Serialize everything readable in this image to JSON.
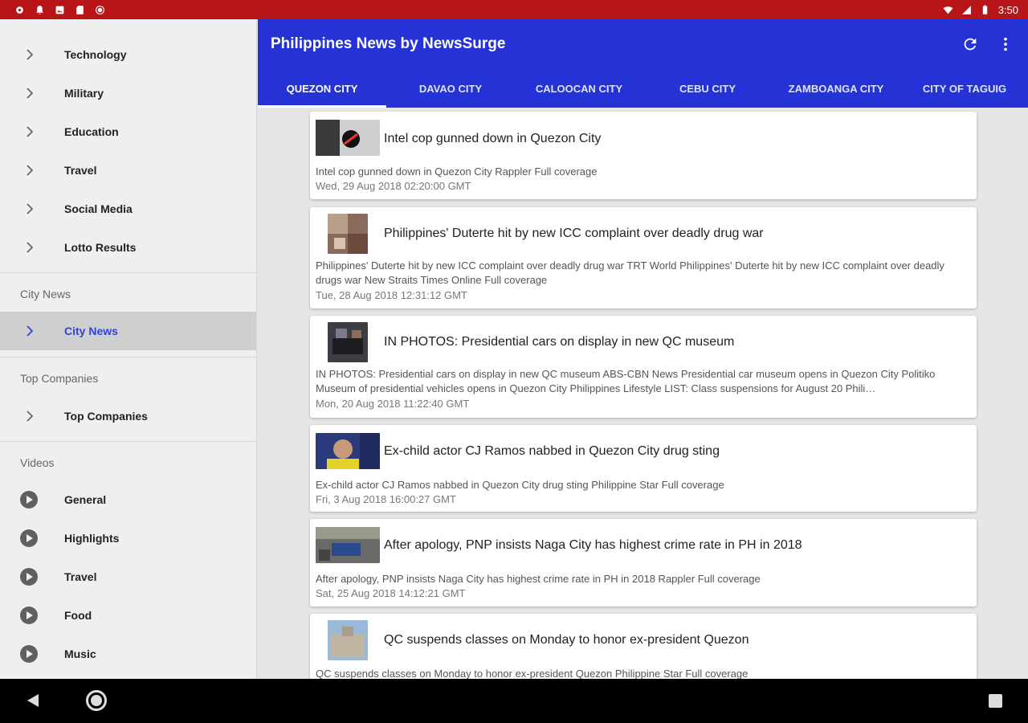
{
  "status_bar": {
    "time": "3:50",
    "bg": "#b71518"
  },
  "app": {
    "title": "Philippines News by NewsSurge",
    "accent": "#2432d6"
  },
  "tabs": [
    "QUEZON CITY",
    "DAVAO CITY",
    "CALOOCAN CITY",
    "CEBU CITY",
    "ZAMBOANGA CITY",
    "CITY OF TAGUIG"
  ],
  "selected_tab": "QUEZON CITY",
  "drawer": {
    "categories": [
      "Technology",
      "Military",
      "Education",
      "Travel",
      "Social Media",
      "Lotto Results"
    ],
    "city_news_header": "City News",
    "city_news_item": "City News",
    "top_companies_header": "Top Companies",
    "top_companies_item": "Top Companies",
    "videos_header": "Videos",
    "videos": [
      "General",
      "Highlights",
      "Travel",
      "Food",
      "Music"
    ]
  },
  "articles": [
    {
      "headline": "Intel cop gunned down in Quezon City",
      "summary": "Intel cop gunned down in Quezon City  Rappler  Full coverage",
      "date": "Wed, 29 Aug 2018 02:20:00 GMT"
    },
    {
      "headline": "Philippines' Duterte hit by new ICC complaint over deadly drug war",
      "summary": "Philippines' Duterte hit by new ICC complaint over deadly drug war  TRT World  Philippines' Duterte hit by new ICC complaint over deadly drugs war  New Straits Times Online  Full coverage",
      "date": "Tue, 28 Aug 2018 12:31:12 GMT"
    },
    {
      "headline": "IN PHOTOS: Presidential cars on display in new QC museum",
      "summary": "IN PHOTOS: Presidential cars on display in new QC museum  ABS-CBN News  Presidential car museum opens in Quezon City  Politiko  Museum of presidential vehicles opens in Quezon City  Philippines Lifestyle  LIST: Class suspensions for August 20  Phili…",
      "date": "Mon, 20 Aug 2018 11:22:40 GMT"
    },
    {
      "headline": "Ex-child actor CJ Ramos nabbed in Quezon City drug sting",
      "summary": "Ex-child actor CJ Ramos nabbed in Quezon City drug sting  Philippine Star  Full coverage",
      "date": "Fri, 3 Aug 2018 16:00:27 GMT"
    },
    {
      "headline": "After apology, PNP insists Naga City has highest crime rate in PH in 2018",
      "summary": "After apology, PNP insists Naga City has highest crime rate in PH in 2018  Rappler  Full coverage",
      "date": "Sat, 25 Aug 2018 14:12:21 GMT"
    },
    {
      "headline": "QC suspends classes on Monday to honor ex-president Quezon",
      "summary": "QC suspends classes on Monday to honor ex-president Quezon  Philippine Star  Full coverage",
      "date": ""
    }
  ]
}
